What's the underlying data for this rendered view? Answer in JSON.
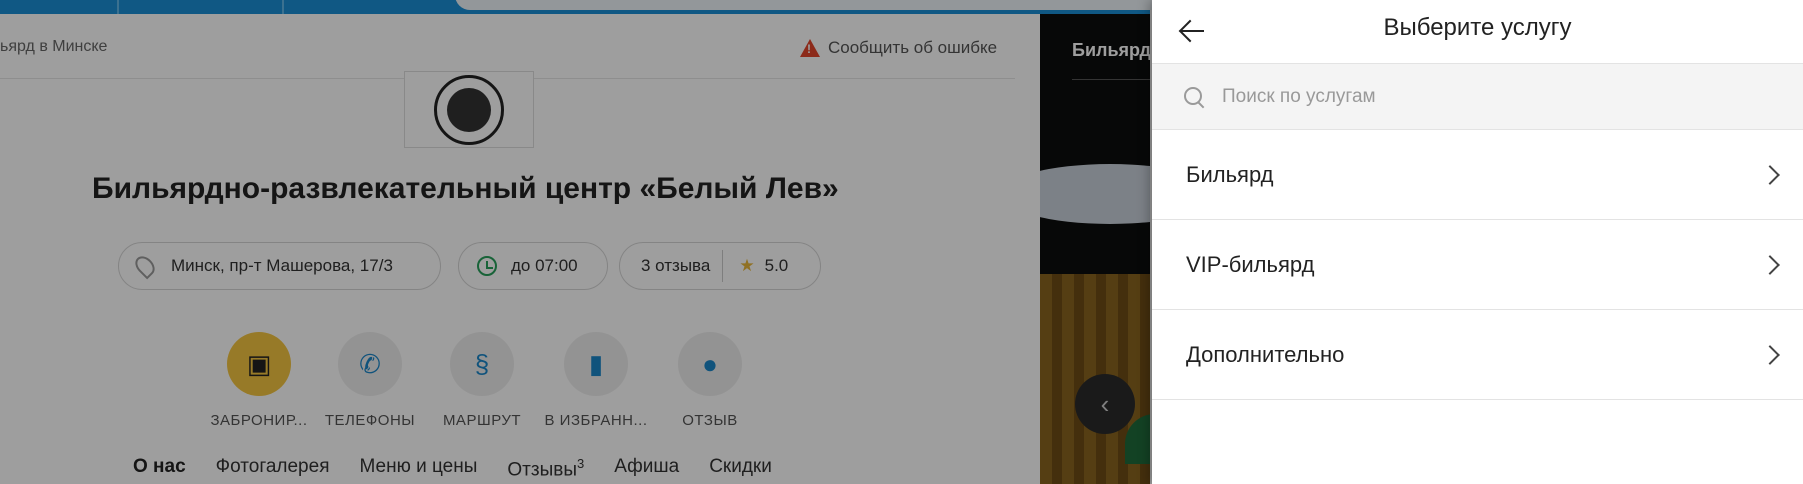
{
  "background": {
    "breadcrumb": "ьярд в Минске",
    "report_link": "Сообщить об ошибке",
    "logo_name": "Белый Лев",
    "title": "Бильярдно-развлекательный центр «Белый Лев»",
    "address": "Минск, пр-т Машерова, 17/3",
    "hours": "до 07:00",
    "reviews_count": "3 отзыва",
    "rating": "5.0",
    "actions": [
      {
        "label": "ЗАБРОНИР...",
        "icon": "calendar-check-icon"
      },
      {
        "label": "ТЕЛЕФОНЫ",
        "icon": "phone-icon"
      },
      {
        "label": "МАРШРУТ",
        "icon": "route-icon"
      },
      {
        "label": "В ИЗБРАНН...",
        "icon": "bookmark-icon"
      },
      {
        "label": "ОТЗЫВ",
        "icon": "chat-icon"
      }
    ],
    "tabs": [
      {
        "label": "О нас"
      },
      {
        "label": "Фотогалерея"
      },
      {
        "label": "Меню и цены"
      },
      {
        "label": "Отзывы",
        "count": "3"
      },
      {
        "label": "Афиша"
      },
      {
        "label": "Скидки"
      }
    ],
    "gallery_title": "Бильярд"
  },
  "panel": {
    "title": "Выберите услугу",
    "search_placeholder": "Поиск по услугам",
    "services": [
      {
        "name": "Бильярд"
      },
      {
        "name": "VIP-бильярд"
      },
      {
        "name": "Дополнительно"
      }
    ]
  }
}
